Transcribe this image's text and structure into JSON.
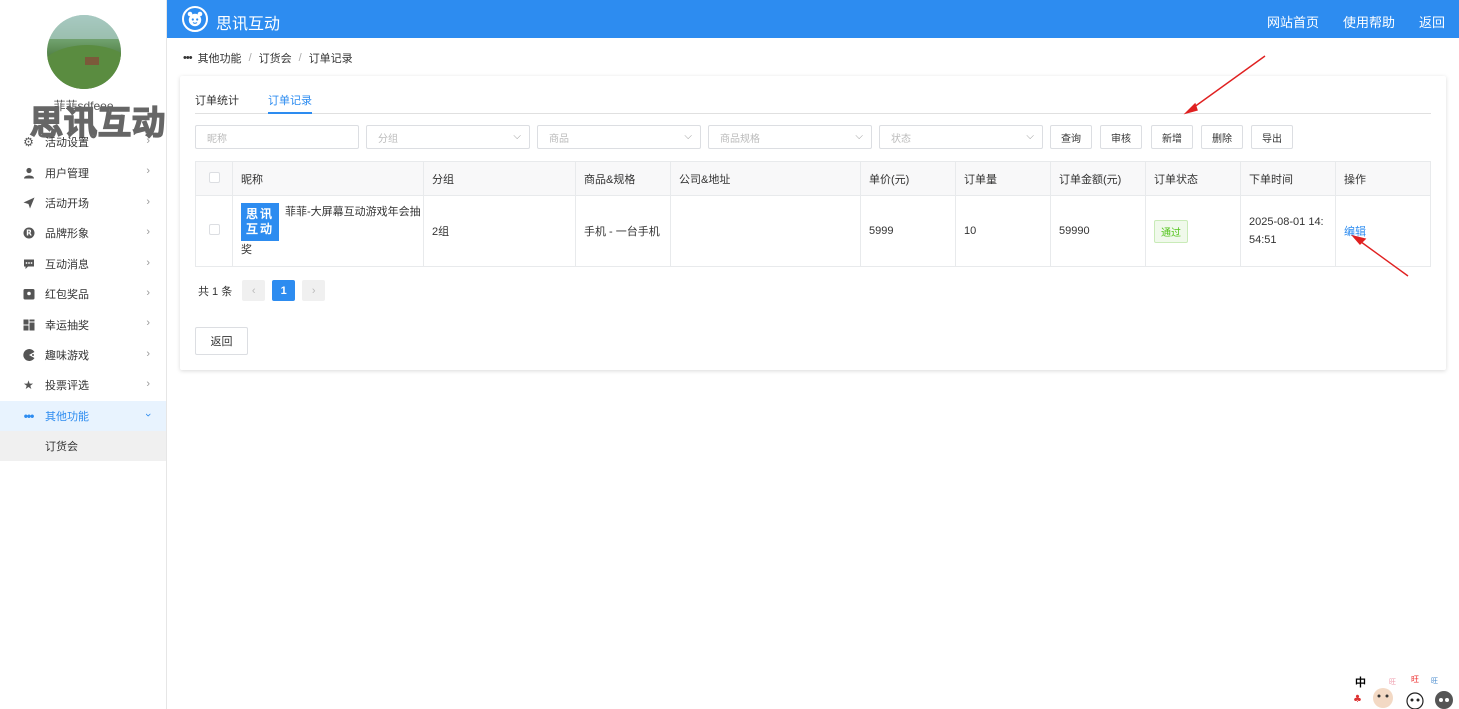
{
  "sidebar": {
    "username": "菲菲sdfeee",
    "watermark": "思讯互动",
    "items": [
      {
        "label": "活动设置",
        "icon": "gear-icon"
      },
      {
        "label": "用户管理",
        "icon": "user-icon"
      },
      {
        "label": "活动开场",
        "icon": "send-icon"
      },
      {
        "label": "品牌形象",
        "icon": "registered-icon"
      },
      {
        "label": "互动消息",
        "icon": "message-icon"
      },
      {
        "label": "红包奖品",
        "icon": "gift-icon"
      },
      {
        "label": "幸运抽奖",
        "icon": "lottery-icon"
      },
      {
        "label": "趣味游戏",
        "icon": "game-icon"
      },
      {
        "label": "投票评选",
        "icon": "star-icon"
      },
      {
        "label": "其他功能",
        "icon": "more-icon"
      }
    ],
    "subitem": "订货会"
  },
  "header": {
    "brand": "思讯互动",
    "nav": [
      "网站首页",
      "使用帮助",
      "返回"
    ]
  },
  "breadcrumb": [
    "其他功能",
    "订货会",
    "订单记录"
  ],
  "tabs": [
    "订单统计",
    "订单记录"
  ],
  "filters": {
    "nickname_placeholder": "昵称",
    "group_placeholder": "分组",
    "product_placeholder": "商品",
    "spec_placeholder": "商品规格",
    "status_placeholder": "状态",
    "buttons": [
      "查询",
      "审核",
      "新增",
      "删除",
      "导出"
    ]
  },
  "table": {
    "headers": [
      "昵称",
      "分组",
      "商品&规格",
      "公司&地址",
      "单价(元)",
      "订单量",
      "订单金额(元)",
      "订单状态",
      "下单时间",
      "操作"
    ],
    "rows": [
      {
        "logo_text": "思讯互动",
        "nickname": "菲菲-大屏幕互动游戏年会抽奖",
        "group": "2组",
        "product": "手机 - 一台手机",
        "company": "",
        "price": "5999",
        "quantity": "10",
        "amount": "59990",
        "status": "通过",
        "time": "2025-08-01 14:54:51",
        "action": "编辑"
      }
    ]
  },
  "pager": {
    "total": "共 1 条",
    "current": "1"
  },
  "back_label": "返回",
  "colors": {
    "primary": "#2d8cf0",
    "status_green": "#52c41a",
    "arrow_red": "#e02020"
  }
}
